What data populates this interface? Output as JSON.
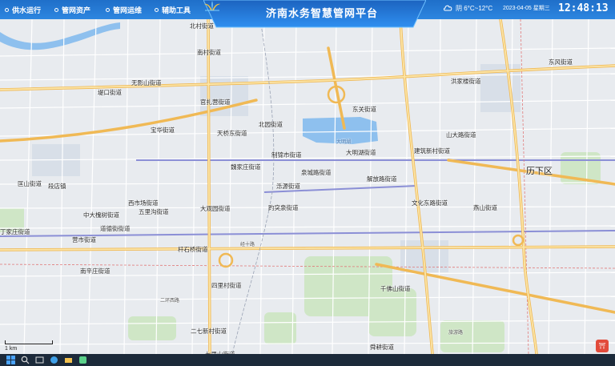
{
  "nav": [
    {
      "label": "供水运行",
      "icon": "water-supply-icon"
    },
    {
      "label": "管网资产",
      "icon": "pipe-asset-icon"
    },
    {
      "label": "管网运维",
      "icon": "maintenance-icon"
    },
    {
      "label": "辅助工具",
      "icon": "tools-icon"
    }
  ],
  "title": "济南水务智慧管网平台",
  "weather": {
    "icon": "cloudy-icon",
    "text": "阴 6°C~12°C"
  },
  "date": "2023-04-05 星期三",
  "clock": "12:48:13",
  "map": {
    "district_label": "历下区",
    "scale_label": "1 km",
    "labels": [
      "无影山街道",
      "北园街道",
      "大明湖街道",
      "东关街道",
      "洪家楼街道",
      "东风街道",
      "山大路街道",
      "官扎营街道",
      "宝华街道",
      "天桥东街道",
      "泉城路街道",
      "解放路街道",
      "建筑新村街道",
      "制锦市街道",
      "魏家庄街道",
      "泺源街道",
      "文化东路街道",
      "燕山街道",
      "段店镇",
      "西市场街道",
      "五里沟街道",
      "大观园街道",
      "趵突泉街道",
      "中大槐树街道",
      "道德街街道",
      "营市街道",
      "杆石桥街道",
      "南辛庄街道",
      "四里村街道",
      "千佛山街道",
      "二七新村街道",
      "七里山街道",
      "舜耕街道",
      "丁家庄街道",
      "匡山街道",
      "南村街道",
      "北村街道",
      "堤口街道",
      "经十路",
      "二环西路",
      "旅游路",
      "大明湖"
    ]
  },
  "taskbar": {
    "icons": [
      "start-icon",
      "search-icon",
      "task-view-icon",
      "browser-icon",
      "folder-icon",
      "app-icon"
    ]
  }
}
